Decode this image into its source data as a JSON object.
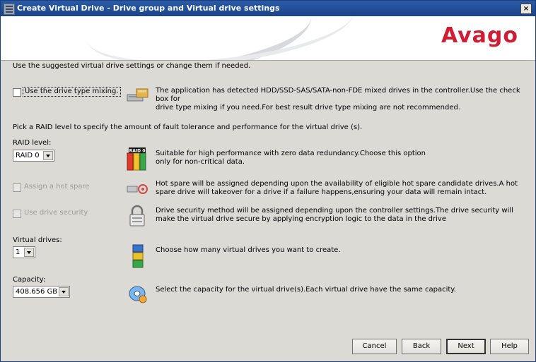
{
  "window": {
    "title": "Create Virtual Drive - Drive group and Virtual drive settings",
    "close_label": "×"
  },
  "banner": {
    "logo": "Avago",
    "brand_color": "#cc1f36"
  },
  "intro": "Use the suggested virtual drive settings or change them if needed.",
  "mixing": {
    "checkbox_label": "Use the drive type mixing.",
    "checked": false,
    "icon": "drive-mixing-icon",
    "desc_line1": "The application has detected HDD/SSD-SAS/SATA-non-FDE mixed drives in the controller.Use the check box for",
    "desc_line2": "drive type mixing if you need.For best result drive type mixing are not recommended."
  },
  "raid_prompt": "Pick a RAID level to specify the amount of fault tolerance and performance for the virtual drive (s).",
  "raid": {
    "label": "RAID level:",
    "selected": "RAID 0",
    "icon": "raid-level-icon",
    "icon_badge": "RAID 0",
    "desc_line1": "Suitable for high performance with zero data redundancy.Choose this option",
    "desc_line2": "only for non-critical data."
  },
  "hot_spare": {
    "checkbox_label": "Assign a hot spare",
    "enabled": false,
    "icon": "hot-spare-icon",
    "desc_line1": "Hot spare will be assigned depending upon the availability of eligible hot spare candidate drives.A hot",
    "desc_line2": "spare drive will takeover for a drive if a failure happens,ensuring your data will remain intact."
  },
  "drive_security": {
    "checkbox_label": "Use drive security",
    "enabled": false,
    "icon": "lock-icon",
    "desc_line1": "Drive security method will be assigned depending upon the controller settings.The drive security will",
    "desc_line2": "make the virtual drive secure by applying encryption logic to the data in the drive"
  },
  "virtual_drives": {
    "label": "Virtual drives:",
    "selected": "1",
    "icon": "virtual-drive-stack-icon",
    "desc": "Choose how many virtual drives you want to create."
  },
  "capacity": {
    "label": "Capacity:",
    "selected": "408.656 GB",
    "icon": "capacity-disk-icon",
    "desc": "Select the capacity for the virtual drive(s).Each virtual drive have the same capacity."
  },
  "buttons": {
    "cancel": "Cancel",
    "back": "Back",
    "next": "Next",
    "help": "Help"
  }
}
